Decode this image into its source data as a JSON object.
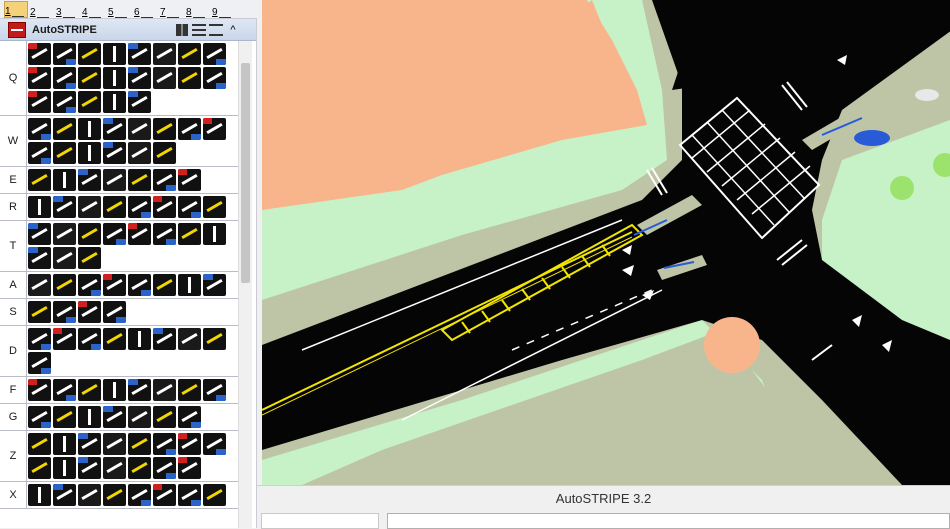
{
  "toolbar": {
    "items": [
      {
        "label": "1",
        "active": true
      },
      {
        "label": "2",
        "active": false
      },
      {
        "label": "3",
        "active": false
      },
      {
        "label": "4",
        "active": false
      },
      {
        "label": "5",
        "active": false
      },
      {
        "label": "6",
        "active": false
      },
      {
        "label": "7",
        "active": false
      },
      {
        "label": "8",
        "active": false
      },
      {
        "label": "9",
        "active": false
      }
    ]
  },
  "palette": {
    "title": "AutoSTRIPE",
    "view_buttons": [
      "grid-icon",
      "list-icon",
      "details-icon",
      "collapse-up-icon"
    ],
    "rows": [
      {
        "letter": "Q",
        "count": 21
      },
      {
        "letter": "W",
        "count": 14
      },
      {
        "letter": "E",
        "count": 7
      },
      {
        "letter": "R",
        "count": 8
      },
      {
        "letter": "T",
        "count": 11
      },
      {
        "letter": "A",
        "count": 8
      },
      {
        "letter": "S",
        "count": 4
      },
      {
        "letter": "D",
        "count": 9
      },
      {
        "letter": "F",
        "count": 8
      },
      {
        "letter": "G",
        "count": 7
      },
      {
        "letter": "Z",
        "count": 15
      },
      {
        "letter": "X",
        "count": 8
      }
    ]
  },
  "status": {
    "title": "AutoSTRIPE 3.2"
  },
  "colors": {
    "road": "#050505",
    "building_orange": "#f8b58c",
    "grass": "#c7f2c8",
    "sidewalk": "#c0c6a8",
    "yellow_line": "#f2e500",
    "lane_white": "#ffffff",
    "blue_arrow": "#2a5bd7",
    "gray_building": "#d2d2d2"
  }
}
